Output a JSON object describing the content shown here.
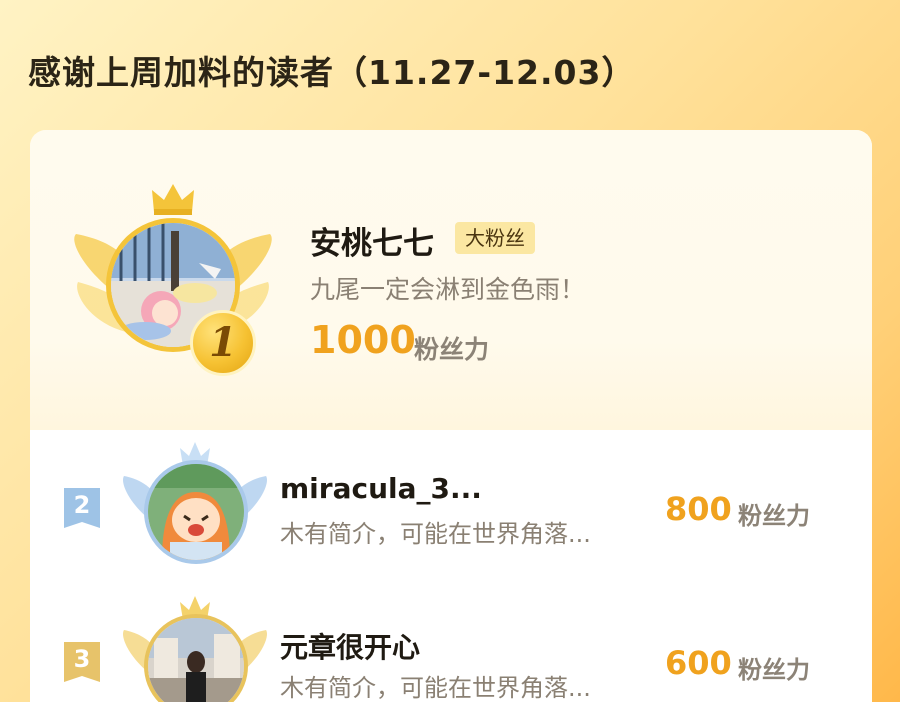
{
  "header": {
    "title": "感谢上周加料的读者（11.27-12.03）"
  },
  "top_fan": {
    "rank": "1",
    "name": "安桃七七",
    "badge": "大粉丝",
    "intro": "九尾一定会淋到金色雨！",
    "score": "1000",
    "unit": "粉丝力"
  },
  "fans": [
    {
      "rank": "2",
      "name": "miracula_3...",
      "intro": "木有简介，可能在世界角落...",
      "score": "800",
      "unit": "粉丝力"
    },
    {
      "rank": "3",
      "name": "元章很开心",
      "intro": "木有简介，可能在世界角落...",
      "score": "600",
      "unit": "粉丝力"
    }
  ],
  "colors": {
    "accent": "#f0a21e",
    "rank2": "#9ec3e6",
    "rank3": "#e7c36a"
  },
  "icons": [
    "crown-icon",
    "wings-icon"
  ]
}
